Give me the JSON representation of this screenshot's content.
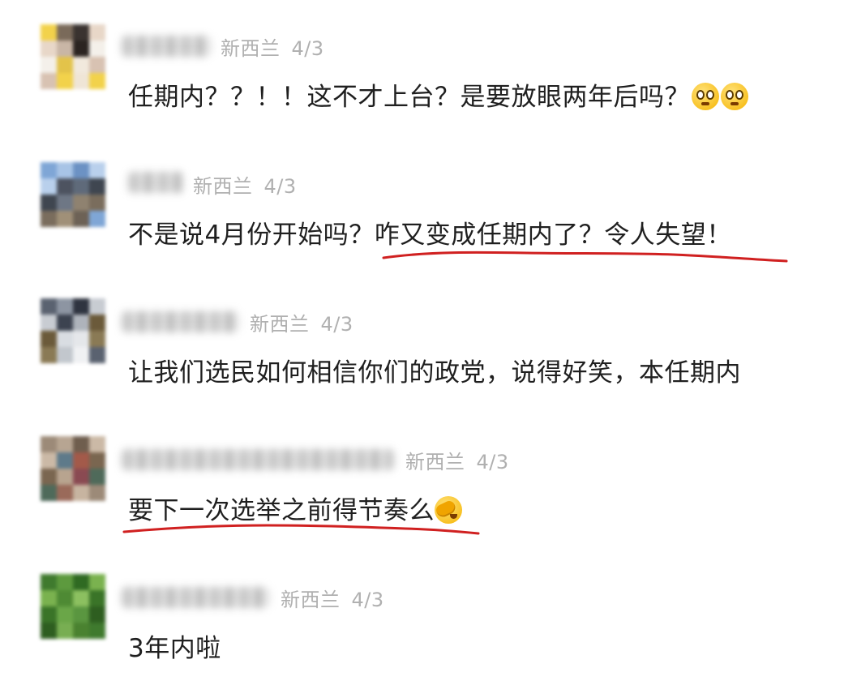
{
  "comments": [
    {
      "region": "新西兰",
      "date": "4/3",
      "text": "任期内？？！！这不才上台？是要放眼两年后吗？",
      "avatar_colors": [
        "#f2d24b",
        "#7a6a5a",
        "#3a3330",
        "#e8d7c8",
        "#c9b6a6",
        "#2b2421",
        "#f4f0ea",
        "#e3c34a",
        "#f1e9dd",
        "#d8c2b2",
        "#f2d24b",
        "#efe5d6"
      ],
      "highlighted": false
    },
    {
      "region": "新西兰",
      "date": "4/3",
      "text_plain": "不是说4月份开始吗？",
      "text_marked": "咋又变成任期内了？令人失望！",
      "avatar_colors": [
        "#7fa6d6",
        "#a8c4e6",
        "#6c92c4",
        "#b9d0ec",
        "#4d5360",
        "#5f6a7a",
        "#3f4650",
        "#6e7785",
        "#8f8270",
        "#7a6d5d",
        "#a09078",
        "#6d6256"
      ],
      "highlighted": true
    },
    {
      "region": "新西兰",
      "date": "4/3",
      "text": "让我们选民如何相信你们的政党，说得好笑，本任期内",
      "avatar_colors": [
        "#5a6270",
        "#8d95a2",
        "#2f3440",
        "#c8ccd2",
        "#3c4350",
        "#aeb3bb",
        "#6b5a3a",
        "#d9dde2",
        "#e5e7ea",
        "#8a7a55",
        "#c2c7cd",
        "#f0f1f3"
      ],
      "highlighted": false
    },
    {
      "region": "新西兰",
      "date": "4/3",
      "text": "要下一次选举之前得节奏么",
      "avatar_colors": [
        "#9c8a78",
        "#b7a592",
        "#6f5e4e",
        "#cbb9a6",
        "#5e7a8a",
        "#a35a4a",
        "#7a6650",
        "#b8a48f",
        "#8a4a52",
        "#4f6a5a",
        "#9a6a5a",
        "#c7b4a0"
      ],
      "highlighted": true
    },
    {
      "region": "新西兰",
      "date": "4/3",
      "text": "3年内啦",
      "avatar_colors": [
        "#3f7a2e",
        "#5d9a3e",
        "#2f6a22",
        "#7ab24f",
        "#4e8a34",
        "#8cc060",
        "#3a7428",
        "#6aa648",
        "#5a9640",
        "#2e5e20",
        "#78ae52",
        "#4a8230"
      ],
      "highlighted": false
    }
  ],
  "colors": {
    "underline": "#d02020",
    "meta_text": "#b0b0b0",
    "body_text": "#1f1f1f"
  },
  "icons": {
    "comment_1_emoji": "pleading-face-emoji",
    "comment_4_emoji": "facepalm-emoji"
  }
}
